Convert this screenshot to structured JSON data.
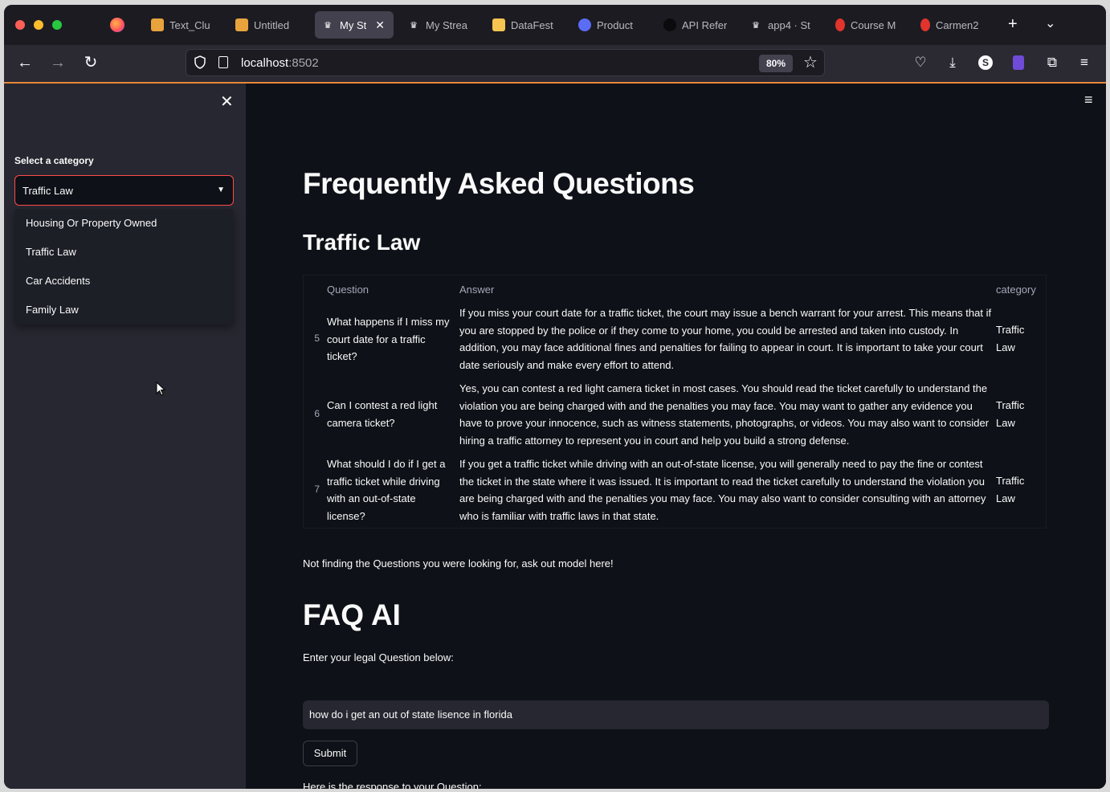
{
  "browser": {
    "tabs": [
      {
        "label": "Text_Clu",
        "icon": "book-icon",
        "color": "#e8a33d"
      },
      {
        "label": "Untitled",
        "icon": "book-icon",
        "color": "#e8a33d"
      },
      {
        "label": "My St",
        "icon": "crown-icon",
        "color": "#ffffff"
      },
      {
        "label": "My Strea",
        "icon": "crown-icon",
        "color": "#ffffff"
      },
      {
        "label": "DataFest",
        "icon": "folder-icon",
        "color": "#f5c451"
      },
      {
        "label": "Product",
        "icon": "globe-icon",
        "color": "#5b6cf5"
      },
      {
        "label": "API Refer",
        "icon": "openai-icon",
        "color": "#1c1b22"
      },
      {
        "label": "app4 · St",
        "icon": "crown-icon",
        "color": "#ffffff"
      },
      {
        "label": "Course M",
        "icon": "opera-icon",
        "color": "#e0342c"
      },
      {
        "label": "Carmen2",
        "icon": "opera-icon",
        "color": "#e0342c"
      }
    ],
    "url_host": "localhost",
    "url_port": ":8502",
    "zoom": "80%"
  },
  "sidebar": {
    "label": "Select a category",
    "selected": "Traffic Law",
    "options": [
      "Housing Or Property Owned",
      "Traffic Law",
      "Car Accidents",
      "Family Law"
    ]
  },
  "main": {
    "title": "Frequently Asked Questions",
    "subtitle": "Traffic Law",
    "table": {
      "columns": [
        "Question",
        "Answer",
        "category"
      ],
      "rows": [
        {
          "index": "5",
          "question": "What happens if I miss my court date for a traffic ticket?",
          "answer": "If you miss your court date for a traffic ticket, the court may issue a bench warrant for your arrest. This means that if you are stopped by the police or if they come to your home, you could be arrested and taken into custody. In addition, you may face additional fines and penalties for failing to appear in court. It is important to take your court date seriously and make every effort to attend.",
          "category": "Traffic Law"
        },
        {
          "index": "6",
          "question": "Can I contest a red light camera ticket?",
          "answer": "Yes, you can contest a red light camera ticket in most cases. You should read the ticket carefully to understand the violation you are being charged with and the penalties you may face. You may want to gather any evidence you have to prove your innocence, such as witness statements, photographs, or videos. You may also want to consider hiring a traffic attorney to represent you in court and help you build a strong defense.",
          "category": "Traffic Law"
        },
        {
          "index": "7",
          "question": "What should I do if I get a traffic ticket while driving with an out-of-state license?",
          "answer": "If you get a traffic ticket while driving with an out-of-state license, you will generally need to pay the fine or contest the ticket in the state where it was issued. It is important to read the ticket carefully to understand the violation you are being charged with and the penalties you may face. You may also want to consider consulting with an attorney who is familiar with traffic laws in that state.",
          "category": "Traffic Law"
        }
      ]
    },
    "not_finding": "Not finding the Questions you were looking for, ask out model here!",
    "ai_title": "FAQ AI",
    "input_label": "Enter your legal Question below:",
    "input_value": "how do i get an out of state lisence in florida",
    "submit_label": "Submit",
    "response_label": "Here is the response to your Question:"
  }
}
